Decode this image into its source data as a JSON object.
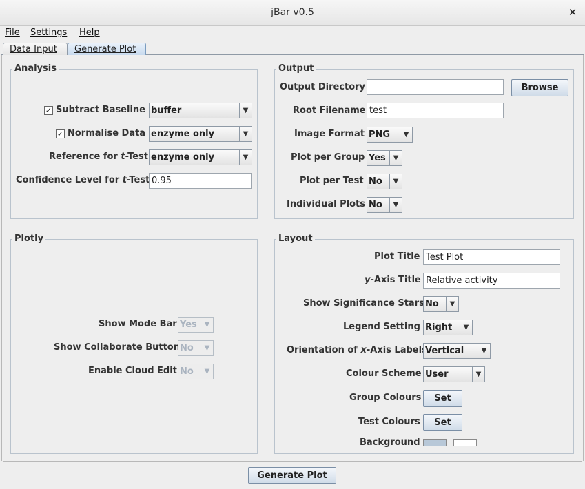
{
  "window": {
    "title": "jBar v0.5"
  },
  "menu": {
    "file": "File",
    "settings": "Settings",
    "help": "Help"
  },
  "tabs": {
    "data_input": "Data Input",
    "generate_plot": "Generate Plot"
  },
  "analysis": {
    "title": "Analysis",
    "subtract_baseline": {
      "label": "Subtract Baseline",
      "checked": true,
      "value": "buffer"
    },
    "normalise_data": {
      "label": "Normalise Data",
      "checked": true,
      "value": "enzyme only"
    },
    "reference_label_pre": "Reference for ",
    "reference_label_t": "t",
    "reference_label_post": "-Test",
    "reference_value": "enzyme only",
    "confidence_label_pre": "Confidence Level for ",
    "confidence_label_t": "t",
    "confidence_label_post": "-Test",
    "confidence_value": "0.95"
  },
  "output": {
    "title": "Output",
    "directory_label": "Output Directory",
    "directory_value": "",
    "browse_label": "Browse",
    "root_filename_label": "Root Filename",
    "root_filename_value": "test",
    "image_format_label": "Image Format",
    "image_format_value": "PNG",
    "plot_per_group_label": "Plot per Group",
    "plot_per_group_value": "Yes",
    "plot_per_test_label": "Plot per Test",
    "plot_per_test_value": "No",
    "individual_plots_label": "Individual Plots",
    "individual_plots_value": "No"
  },
  "plotly": {
    "title": "Plotly",
    "mode_bar_label": "Show Mode Bar",
    "mode_bar_value": "Yes",
    "collaborate_label": "Show Collaborate Button",
    "collaborate_value": "No",
    "cloud_edit_label": "Enable Cloud Edit",
    "cloud_edit_value": "No"
  },
  "layout": {
    "title": "Layout",
    "plot_title_label": "Plot Title",
    "plot_title_value": "Test Plot",
    "y_axis_label_y": "y",
    "y_axis_label_post": "-Axis Title",
    "y_axis_value": "Relative activity",
    "significance_label": "Show Significance Stars",
    "significance_value": "No",
    "legend_label": "Legend Setting",
    "legend_value": "Right",
    "orientation_label_pre": "Orientation of ",
    "orientation_label_x": "x",
    "orientation_label_post": "-Axis Labels",
    "orientation_value": "Vertical",
    "colour_scheme_label": "Colour Scheme",
    "colour_scheme_value": "User",
    "group_colours_label": "Group Colours",
    "test_colours_label": "Test Colours",
    "set_label": "Set",
    "background_label": "Background",
    "background_colors": [
      "#b8c8d8",
      "#ffffff"
    ]
  },
  "footer": {
    "generate_label": "Generate Plot"
  }
}
